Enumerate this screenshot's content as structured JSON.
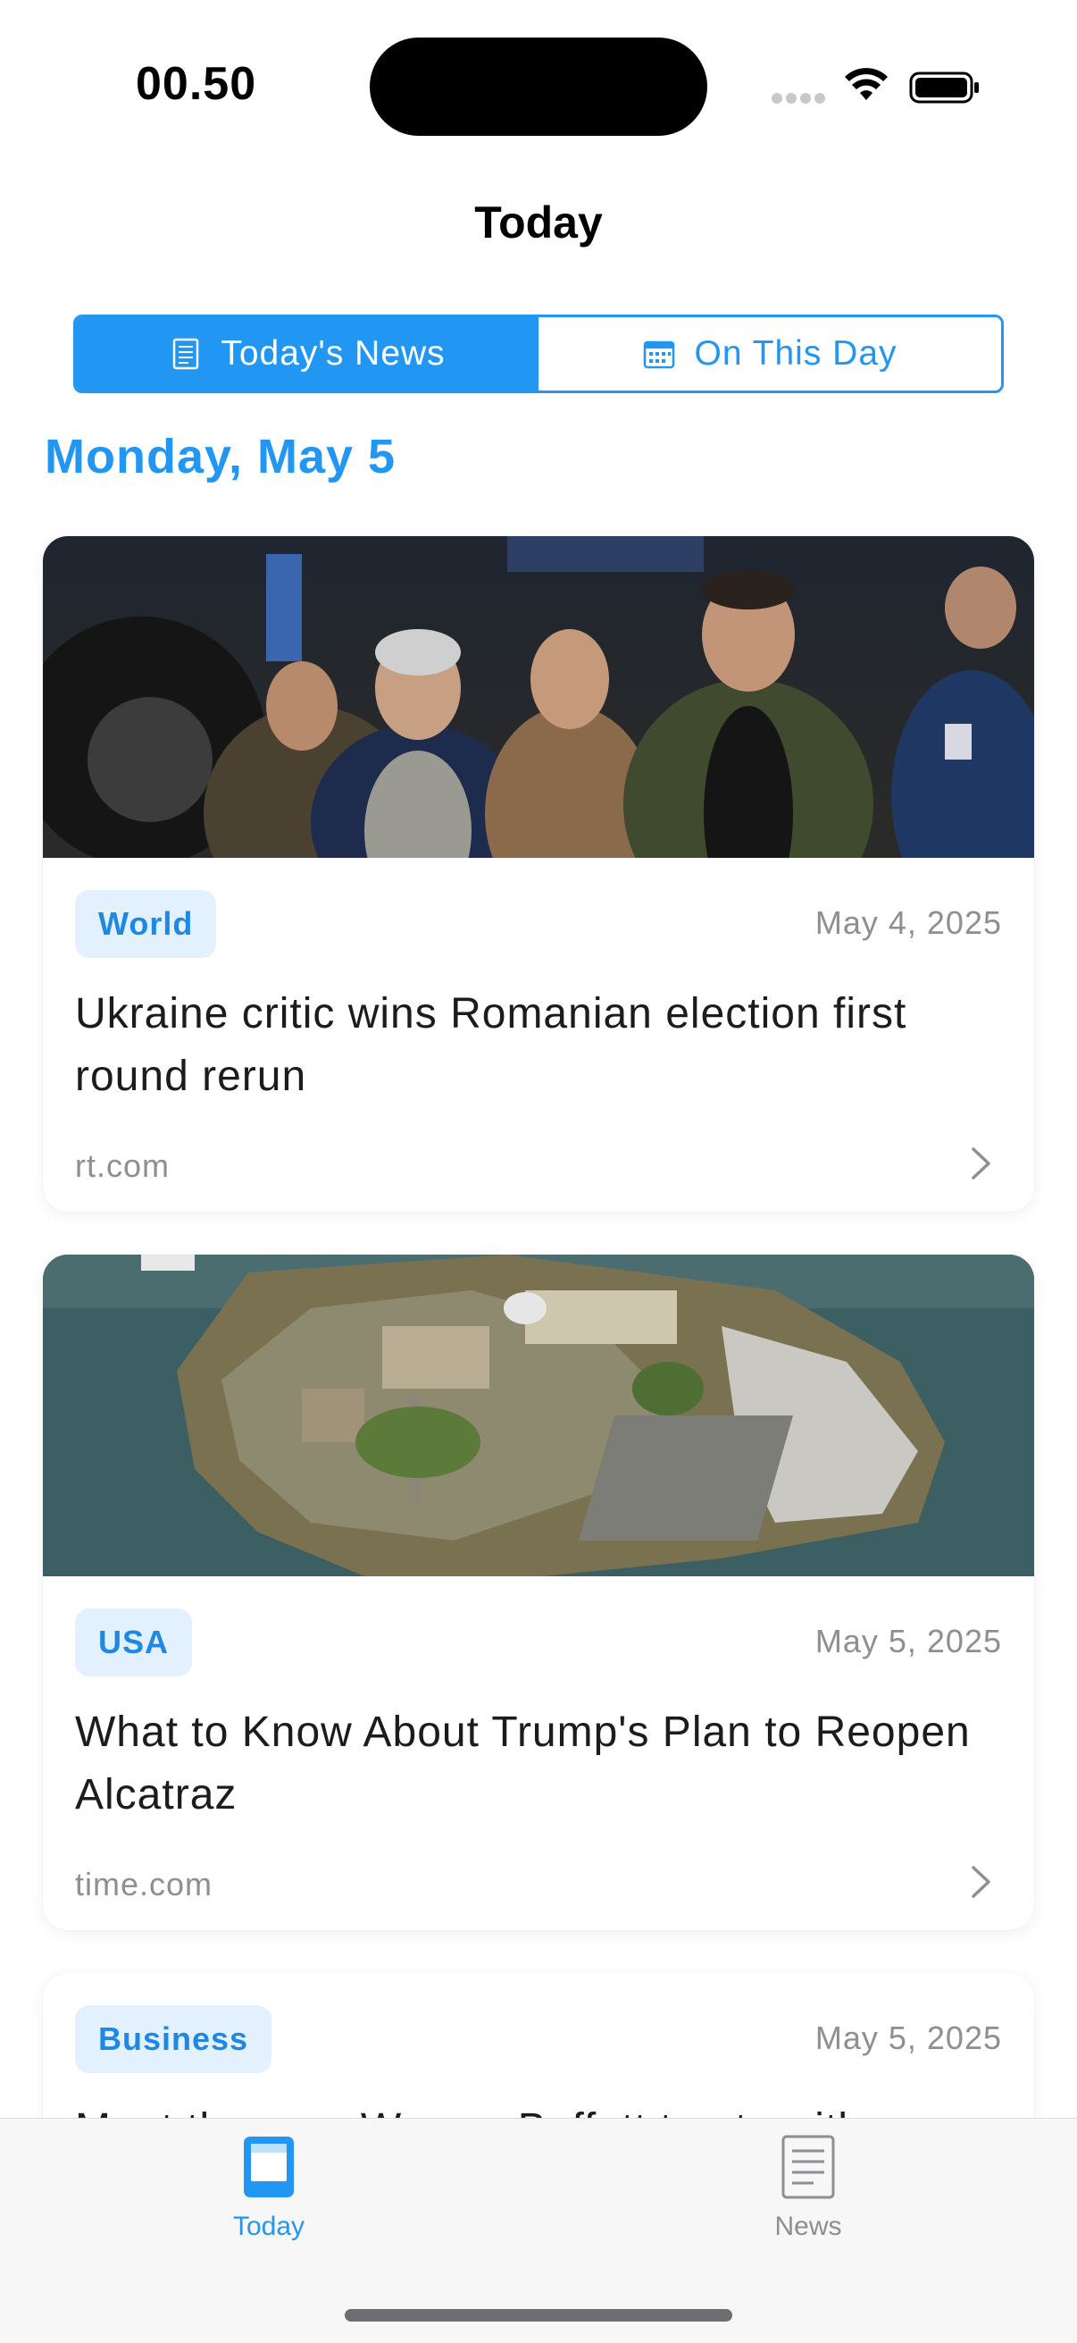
{
  "status_bar": {
    "time": "00.50",
    "icons": [
      "signal-dots-icon",
      "wifi-icon",
      "battery-icon"
    ]
  },
  "nav": {
    "title": "Today"
  },
  "segmented": {
    "today_label": "Today's News",
    "today_icon": "newspaper-icon",
    "history_label": "On This Day",
    "history_icon": "calendar-icon",
    "selected": "Today's News"
  },
  "date_heading": "Monday, May 5",
  "articles": [
    {
      "category": "World",
      "date": "May 4, 2025",
      "headline": "Ukraine critic wins Romanian election first round rerun",
      "source": "rt.com",
      "image": "photo of a crowd of men surrounded by press cameras"
    },
    {
      "category": "USA",
      "date": "May 5, 2025",
      "headline": "What to Know About Trump's Plan to Reopen Alcatraz",
      "source": "time.com",
      "image": "aerial photo of Alcatraz island"
    },
    {
      "category": "Business",
      "date": "May 5, 2025",
      "headline": "Meet the man Warren Buffett trusts with"
    }
  ],
  "tabbar": {
    "tabs": [
      {
        "label": "Today",
        "icon": "book-icon",
        "active": true
      },
      {
        "label": "News",
        "icon": "newspaper-icon",
        "active": false
      }
    ]
  },
  "colors": {
    "accent": "#2196f3",
    "tag_background": "#e3f0fd",
    "secondary_text": "#8e8e93"
  }
}
